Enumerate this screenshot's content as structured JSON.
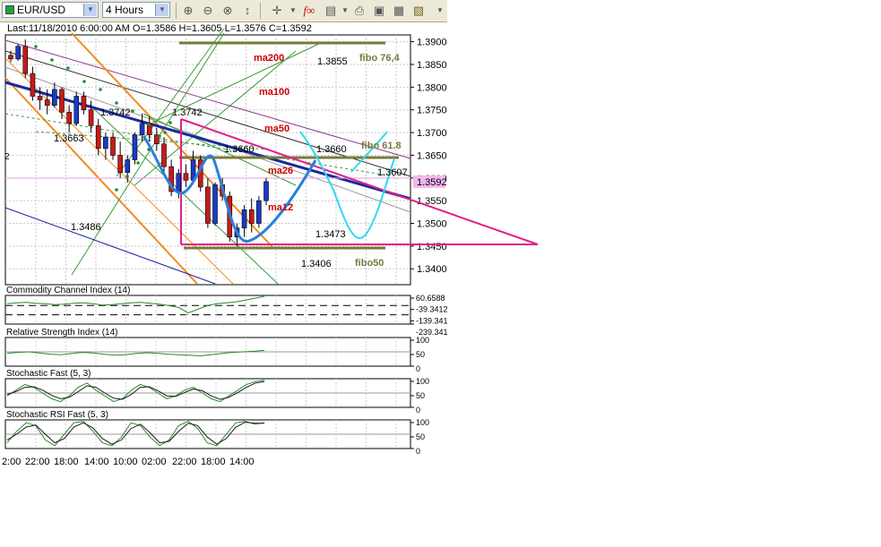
{
  "toolbar": {
    "symbol": "EUR/USD",
    "timeframe": "4 Hours",
    "icons": [
      "zoom-in-icon",
      "zoom-out-icon",
      "zoom-fit-icon",
      "vertical-scale-icon",
      "crosshair-icon",
      "dropdown-icon",
      "function-icon",
      "chart-type-icon",
      "print-icon",
      "save-icon",
      "properties-icon",
      "export-icon"
    ]
  },
  "info": {
    "text": "Last:11/18/2010 6:00:00 AM O=1.3586 H=1.3605 L=1.3576 C=1.3592"
  },
  "main_chart": {
    "y_ticks": [
      "1.3900",
      "1.3850",
      "1.3800",
      "1.3750",
      "1.3700",
      "1.3650",
      "1.3600",
      "1.3550",
      "1.3500",
      "1.3450",
      "1.3400"
    ],
    "current_price": "1.3592",
    "left_edge_label": "2",
    "annotations": {
      "ma200": "ma200",
      "ma100": "ma100",
      "ma50": "ma50",
      "ma26": "ma26",
      "ma12": "ma12",
      "fibo764": "fibo 76,4",
      "fibo618": "fibo 61.8",
      "fibo50": "fibo50",
      "l13855": "1.3855",
      "l13742a": "1.3742",
      "l13742b": "1.3742",
      "l13663": "1.3663",
      "l13660a": "1.3660",
      "l13660b": "1.3660",
      "l13607": "1.3607",
      "l13486": "1.3486",
      "l13473": "1.3473",
      "l13406": "1.3406"
    }
  },
  "indicators": [
    {
      "title": "Commodity Channel Index (14)",
      "ticks": [
        "60.6588",
        "-39.3412",
        "-139.341",
        "-239.341"
      ]
    },
    {
      "title": "Relative Strength Index (14)",
      "ticks": [
        "100",
        "50",
        "0"
      ]
    },
    {
      "title": "Stochastic Fast (5, 3)",
      "ticks": [
        "100",
        "50",
        "0"
      ]
    },
    {
      "title": "Stochastic RSI Fast (5, 3)",
      "ticks": [
        "100",
        "50",
        "0"
      ]
    }
  ],
  "x_axis": [
    "2:00",
    "22:00",
    "18:00",
    "14:00",
    "10:00",
    "02:00",
    "22:00",
    "18:00",
    "14:00"
  ],
  "colors": {
    "ma200": "#cc0000",
    "fibo": "#7a7a3a",
    "pink": "#e0208a",
    "blue_trend": "#1a2a9a",
    "cyan_curve": "#30d8f0",
    "blue_curve": "#2a80d8",
    "bull": "#1a3ac8",
    "bear": "#c81a1a"
  },
  "candles": [
    [
      1.387,
      1.388,
      1.3855,
      1.3862
    ],
    [
      1.3862,
      1.3895,
      1.3858,
      1.389
    ],
    [
      1.389,
      1.3905,
      1.382,
      1.383
    ],
    [
      1.383,
      1.3845,
      1.377,
      1.378
    ],
    [
      1.378,
      1.38,
      1.375,
      1.3772
    ],
    [
      1.3772,
      1.3795,
      1.374,
      1.376
    ],
    [
      1.376,
      1.381,
      1.3755,
      1.3795
    ],
    [
      1.3795,
      1.38,
      1.373,
      1.3745
    ],
    [
      1.3745,
      1.376,
      1.37,
      1.372
    ],
    [
      1.372,
      1.379,
      1.3715,
      1.378
    ],
    [
      1.378,
      1.379,
      1.374,
      1.375
    ],
    [
      1.375,
      1.377,
      1.37,
      1.3715
    ],
    [
      1.3715,
      1.373,
      1.365,
      1.3665
    ],
    [
      1.3665,
      1.37,
      1.364,
      1.369
    ],
    [
      1.369,
      1.37,
      1.364,
      1.365
    ],
    [
      1.365,
      1.368,
      1.36,
      1.3612
    ],
    [
      1.3612,
      1.365,
      1.359,
      1.364
    ],
    [
      1.364,
      1.37,
      1.363,
      1.3695
    ],
    [
      1.3695,
      1.3742,
      1.368,
      1.372
    ],
    [
      1.372,
      1.3735,
      1.368,
      1.3695
    ],
    [
      1.3695,
      1.371,
      1.366,
      1.3675
    ],
    [
      1.3675,
      1.369,
      1.361,
      1.3625
    ],
    [
      1.3625,
      1.364,
      1.356,
      1.357
    ],
    [
      1.357,
      1.362,
      1.3555,
      1.361
    ],
    [
      1.361,
      1.363,
      1.358,
      1.3595
    ],
    [
      1.3595,
      1.366,
      1.359,
      1.364
    ],
    [
      1.364,
      1.365,
      1.357,
      1.358
    ],
    [
      1.358,
      1.36,
      1.349,
      1.35
    ],
    [
      1.35,
      1.359,
      1.3495,
      1.3585
    ],
    [
      1.3585,
      1.36,
      1.355,
      1.356
    ],
    [
      1.356,
      1.357,
      1.346,
      1.347
    ],
    [
      1.347,
      1.35,
      1.345,
      1.349
    ],
    [
      1.349,
      1.354,
      1.347,
      1.353
    ],
    [
      1.353,
      1.3555,
      1.348,
      1.35
    ],
    [
      1.35,
      1.356,
      1.349,
      1.355
    ],
    [
      1.355,
      1.36,
      1.354,
      1.3592
    ]
  ],
  "cci_values": [
    -20,
    -10,
    -5,
    -15,
    -20,
    -30,
    -25,
    -15,
    -10,
    -20,
    -35,
    -30,
    -20,
    -10,
    -5,
    -15,
    -25,
    -40,
    -60,
    -120,
    -80,
    -40,
    -20,
    -10,
    0,
    20,
    40,
    60
  ],
  "rsi_values": [
    45,
    48,
    50,
    46,
    42,
    40,
    44,
    48,
    46,
    42,
    38,
    40,
    44,
    47,
    45,
    42,
    40,
    38,
    36,
    40,
    44,
    48,
    50,
    52,
    55
  ],
  "stoch_values": [
    40,
    60,
    80,
    70,
    50,
    30,
    20,
    40,
    70,
    85,
    60,
    40,
    20,
    30,
    60,
    80,
    70,
    50,
    30,
    40,
    60,
    70,
    50,
    30,
    20,
    40,
    60,
    80,
    90,
    95
  ],
  "stoch_signal": [
    45,
    55,
    70,
    72,
    60,
    42,
    30,
    35,
    55,
    75,
    70,
    50,
    32,
    28,
    45,
    70,
    72,
    58,
    40,
    38,
    52,
    64,
    58,
    40,
    28,
    35,
    52,
    70,
    85,
    90
  ],
  "stochrsi_values": [
    20,
    60,
    90,
    80,
    30,
    10,
    50,
    90,
    95,
    60,
    20,
    10,
    40,
    90,
    80,
    40,
    10,
    30,
    80,
    95,
    70,
    20,
    10,
    50,
    90,
    95,
    85,
    90
  ],
  "stochrsi_signal": [
    30,
    50,
    75,
    82,
    50,
    20,
    35,
    75,
    90,
    72,
    35,
    15,
    30,
    70,
    85,
    55,
    20,
    25,
    60,
    88,
    80,
    40,
    15,
    35,
    75,
    92,
    88,
    88
  ]
}
